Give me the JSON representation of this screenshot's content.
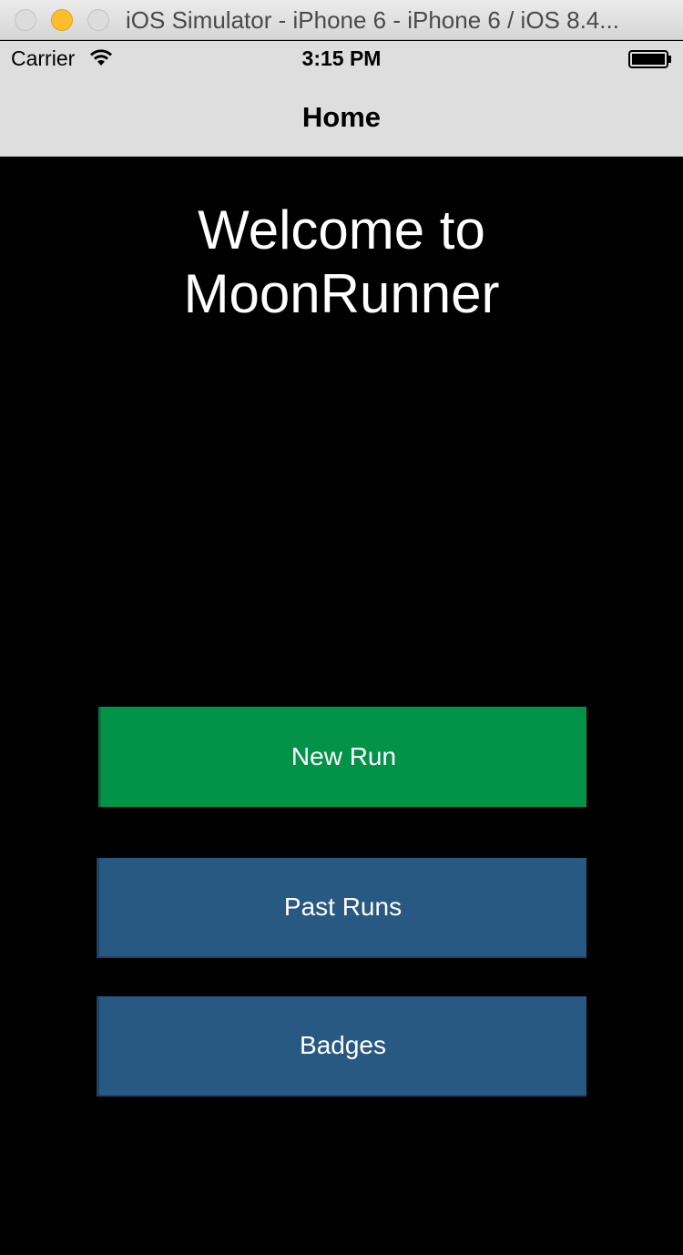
{
  "window": {
    "title": "iOS Simulator - iPhone 6 - iPhone 6 / iOS 8.4..."
  },
  "status_bar": {
    "carrier": "Carrier",
    "time": "3:15 PM",
    "wifi_icon": "wifi-icon",
    "battery_icon": "battery-icon"
  },
  "nav_bar": {
    "title": "Home"
  },
  "main": {
    "welcome_line1": "Welcome to",
    "welcome_line2": "MoonRunner",
    "buttons": [
      {
        "label": "New Run",
        "color": "#029349"
      },
      {
        "label": "Past Runs",
        "color": "#285983"
      },
      {
        "label": "Badges",
        "color": "#285983"
      }
    ]
  },
  "colors": {
    "background": "#000000",
    "bar_background": "#dedede",
    "minimize_button": "#ffbd2e"
  }
}
